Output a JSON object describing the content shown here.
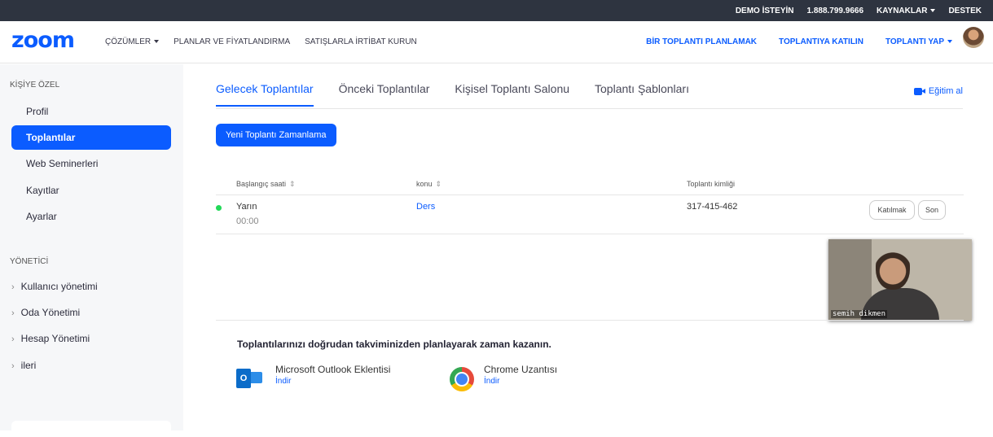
{
  "topbar": {
    "demo": "DEMO İSTEYİN",
    "phone": "1.888.799.9666",
    "resources": "KAYNAKLAR",
    "support": "DESTEK"
  },
  "navbar": {
    "logo": "zoom",
    "left": [
      "ÇÖZÜMLER",
      "PLANLAR VE FİYATLANDIRMA",
      "SATIŞLARLA İRTİBAT KURUN"
    ],
    "schedule": "BİR TOPLANTI PLANLAMAK",
    "join": "TOPLANTIYA KATILIN",
    "host": "TOPLANTI YAP"
  },
  "sidebar": {
    "personal_heading": "KİŞİYE ÖZEL",
    "items": [
      "Profil",
      "Toplantılar",
      "Web Seminerleri",
      "Kayıtlar",
      "Ayarlar"
    ],
    "active_item": "Toplantılar",
    "admin_heading": "YÖNETİCİ",
    "admin_items": [
      "Kullanıcı yönetimi",
      "Oda Yönetimi",
      "Hesap Yönetimi",
      "ileri"
    ]
  },
  "main": {
    "tabs": [
      "Gelecek Toplantılar",
      "Önceki Toplantılar",
      "Kişisel Toplantı Salonu",
      "Toplantı Şablonları"
    ],
    "active_tab": "Gelecek Toplantılar",
    "training": "Eğitim al",
    "new_meeting_button": "Yeni Toplantı Zamanlama",
    "table": {
      "headers": [
        "Başlangıç saati",
        "konu",
        "Toplantı kimliği"
      ],
      "sort_glyph": "⇕",
      "rows": [
        {
          "day": "Yarın",
          "time": "00:00",
          "topic": "Ders",
          "meeting_id": "317-415-462",
          "join": "Katılmak",
          "end": "Son"
        }
      ]
    }
  },
  "video": {
    "participant": "semih dikmen"
  },
  "promo": {
    "title": "Toplantılarınızı doğrudan takviminizden planlayarak zaman kazanın.",
    "outlook_name": "Microsoft Outlook Eklentisi",
    "outlook_icon_letter": "O",
    "outlook_link": "İndir",
    "chrome_name": "Chrome Uzantısı",
    "chrome_link": "İndir"
  },
  "colors": {
    "accent": "#0b5cff",
    "topbar_bg": "#2e3440",
    "status_green": "#23d959"
  }
}
